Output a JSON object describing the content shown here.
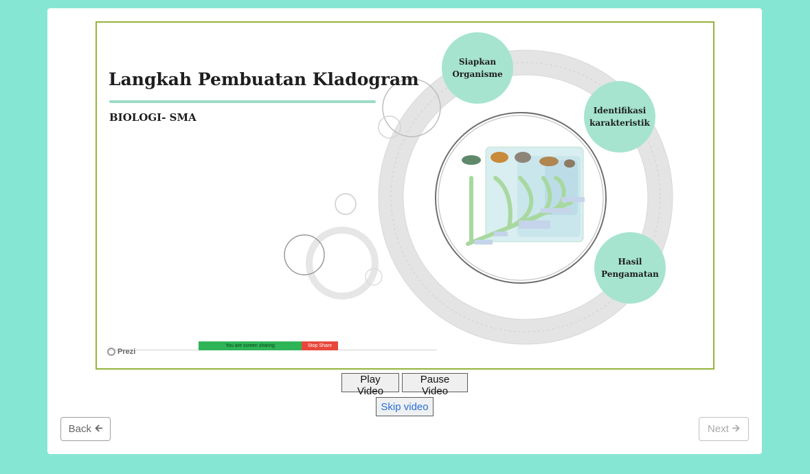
{
  "slide": {
    "title": "Langkah Pembuatan Kladogram",
    "subtitle": "BIOLOGI- SMA",
    "steps": [
      {
        "label": "Siapkan\nOrganisme"
      },
      {
        "label": "Identifikasi\nkarakteristik"
      },
      {
        "label": "Hasil\nPengamatan"
      }
    ],
    "watermark": "Prezi",
    "screen_share_text": "You are screen sharing",
    "stop_share_label": "Stop Share",
    "colors": {
      "frame": "#94b43a",
      "accent_circle": "#a6e4cf",
      "page_bg": "#86e6d4"
    }
  },
  "controls": {
    "play_label": "Play Video",
    "pause_label": "Pause Video",
    "skip_label": "Skip video"
  },
  "nav": {
    "back_label": "Back",
    "next_label": "Next",
    "back_icon": "arrow-left-icon",
    "next_icon": "arrow-right-icon"
  }
}
